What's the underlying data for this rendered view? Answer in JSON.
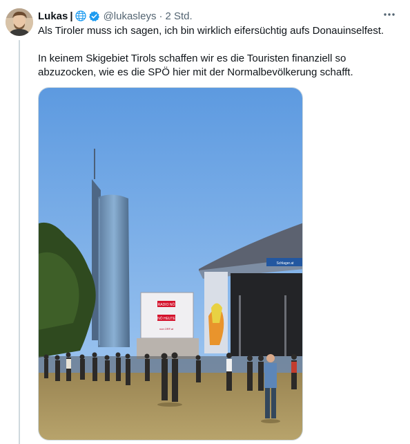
{
  "tweet": {
    "author_name": "Lukas",
    "name_separator": "|",
    "handle": "@lukasleys",
    "time": "2 Std.",
    "text": "Als Tiroler muss ich sagen, ich bin wirklich eifersüchtig aufs Donauinselfest.\n\nIn keinem Skigebiet Tirols schaffen wir es die Touristen finanziell so abzuzocken, wie es die SPÖ hier mit der Normalbevölkerung schafft.",
    "icons": {
      "globe": "globe-icon",
      "verified": "verified-badge-icon",
      "more": "more-options-icon"
    }
  },
  "media": {
    "screen_top_text": "RADIO NÖ",
    "screen_mid_text": "NÖ HEUTE",
    "screen_small_text": "noe.ORF.at",
    "stage_banner_text": "Schlager.at"
  },
  "colors": {
    "text": "#0f1419",
    "secondary": "#536471",
    "verified": "#1d9bf0",
    "sky": "#7fb3ea",
    "grass": "#a5905a"
  }
}
